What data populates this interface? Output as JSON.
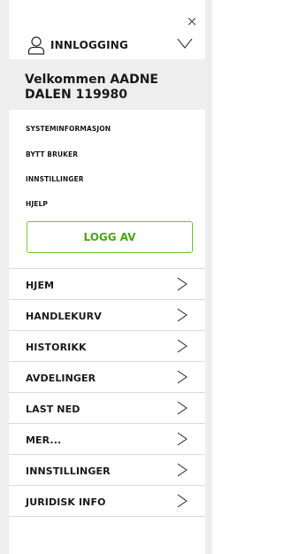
{
  "header": {
    "close_symbol": "×",
    "login_label": "INNLOGGING",
    "user_icon": "user-icon",
    "collapse_icon": "chevron-down-icon"
  },
  "welcome": {
    "text": "Velkommen AADNE DALEN 119980"
  },
  "account_links": [
    {
      "label": "SYSTEMINFORMASJON"
    },
    {
      "label": "BYTT BRUKER"
    },
    {
      "label": "INNSTILLINGER"
    },
    {
      "label": "HJELP"
    }
  ],
  "logout": {
    "label": "LOGG AV",
    "color": "#4aa617",
    "border_color": "#74c53a"
  },
  "menu": [
    {
      "label": "HJEM"
    },
    {
      "label": "HANDLEKURV"
    },
    {
      "label": "HISTORIKK"
    },
    {
      "label": "AVDELINGER"
    },
    {
      "label": "LAST NED"
    },
    {
      "label": "MER..."
    },
    {
      "label": "INNSTILLINGER"
    },
    {
      "label": "JURIDISK INFO"
    }
  ]
}
